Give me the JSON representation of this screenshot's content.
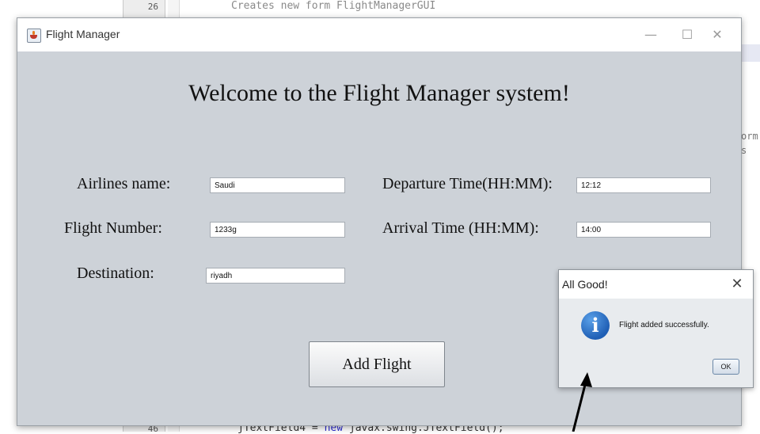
{
  "ide": {
    "line_top": "26",
    "code_top": "Creates new form FlightManagerGUI",
    "side_a": "orm",
    "side_b": "s",
    "line_bottom": "46",
    "code_bottom_var": "jTextField4 = ",
    "code_bottom_kw": "new",
    "code_bottom_rest": " javax.swing.JTextField();"
  },
  "window": {
    "title": "Flight Manager",
    "minimize": "—",
    "maximize": "☐",
    "close": "✕"
  },
  "form": {
    "welcome": "Welcome to the Flight Manager system!",
    "airline_label": "Airlines name:",
    "airline_value": "Saudi",
    "flight_number_label": "Flight Number:",
    "flight_number_value": "1233g",
    "destination_label": "Destination:",
    "destination_value": "riyadh",
    "departure_label": "Departure Time(HH:MM):",
    "departure_value": "12:12",
    "arrival_label": "Arrival Time (HH:MM):",
    "arrival_value": "14:00",
    "add_button": "Add Flight"
  },
  "dialog": {
    "title": "All Good!",
    "close": "✕",
    "icon": "info-icon",
    "icon_glyph": "i",
    "message": "Flight added successfully.",
    "ok": "OK"
  },
  "colors": {
    "window_bg": "#cdd2d8",
    "dialog_bg": "#e8ebee",
    "info_blue": "#1f5fb5"
  }
}
